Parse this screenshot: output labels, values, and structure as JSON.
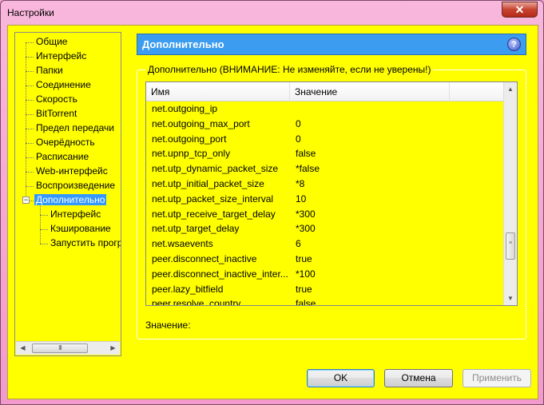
{
  "window": {
    "title": "Настройки",
    "close_glyph": "✕"
  },
  "tree": {
    "items": [
      {
        "label": "Общие"
      },
      {
        "label": "Интерфейс"
      },
      {
        "label": "Папки"
      },
      {
        "label": "Соединение"
      },
      {
        "label": "Скорость"
      },
      {
        "label": "BitTorrent"
      },
      {
        "label": "Предел передачи"
      },
      {
        "label": "Очерёдность"
      },
      {
        "label": "Расписание"
      },
      {
        "label": "Web-интерфейс"
      },
      {
        "label": "Воспроизведение"
      },
      {
        "label": "Дополнительно",
        "selected": true,
        "expander": "⊟"
      },
      {
        "label": "Интерфейс",
        "child": true
      },
      {
        "label": "Кэширование",
        "child": true
      },
      {
        "label": "Запустить прогр",
        "child": true
      }
    ],
    "scroll_left": "◀",
    "scroll_right": "▶",
    "scroll_grip": "III"
  },
  "header": {
    "title": "Дополнительно",
    "help_icon": "help-icon"
  },
  "group": {
    "label": "Дополнительно (ВНИМАНИЕ: Не изменяйте, если не уверены!)"
  },
  "table": {
    "columns": [
      "Имя",
      "Значение"
    ],
    "rows": [
      {
        "name": "net.outgoing_ip",
        "value": ""
      },
      {
        "name": "net.outgoing_max_port",
        "value": "0"
      },
      {
        "name": "net.outgoing_port",
        "value": "0"
      },
      {
        "name": "net.upnp_tcp_only",
        "value": "false"
      },
      {
        "name": "net.utp_dynamic_packet_size",
        "value": "*false"
      },
      {
        "name": "net.utp_initial_packet_size",
        "value": "*8"
      },
      {
        "name": "net.utp_packet_size_interval",
        "value": "10"
      },
      {
        "name": "net.utp_receive_target_delay",
        "value": "*300"
      },
      {
        "name": "net.utp_target_delay",
        "value": "*300"
      },
      {
        "name": "net.wsaevents",
        "value": "6"
      },
      {
        "name": "peer.disconnect_inactive",
        "value": "true"
      },
      {
        "name": "peer.disconnect_inactive_inter...",
        "value": "*100"
      },
      {
        "name": "peer.lazy_bitfield",
        "value": "true"
      },
      {
        "name": "peer.resolve_country",
        "value": "false"
      }
    ],
    "scroll_up": "▲",
    "scroll_down": "▼",
    "scroll_grip": "≡"
  },
  "value_label": "Значение:",
  "buttons": {
    "ok": "OK",
    "cancel": "Отмена",
    "apply": "Применить"
  }
}
